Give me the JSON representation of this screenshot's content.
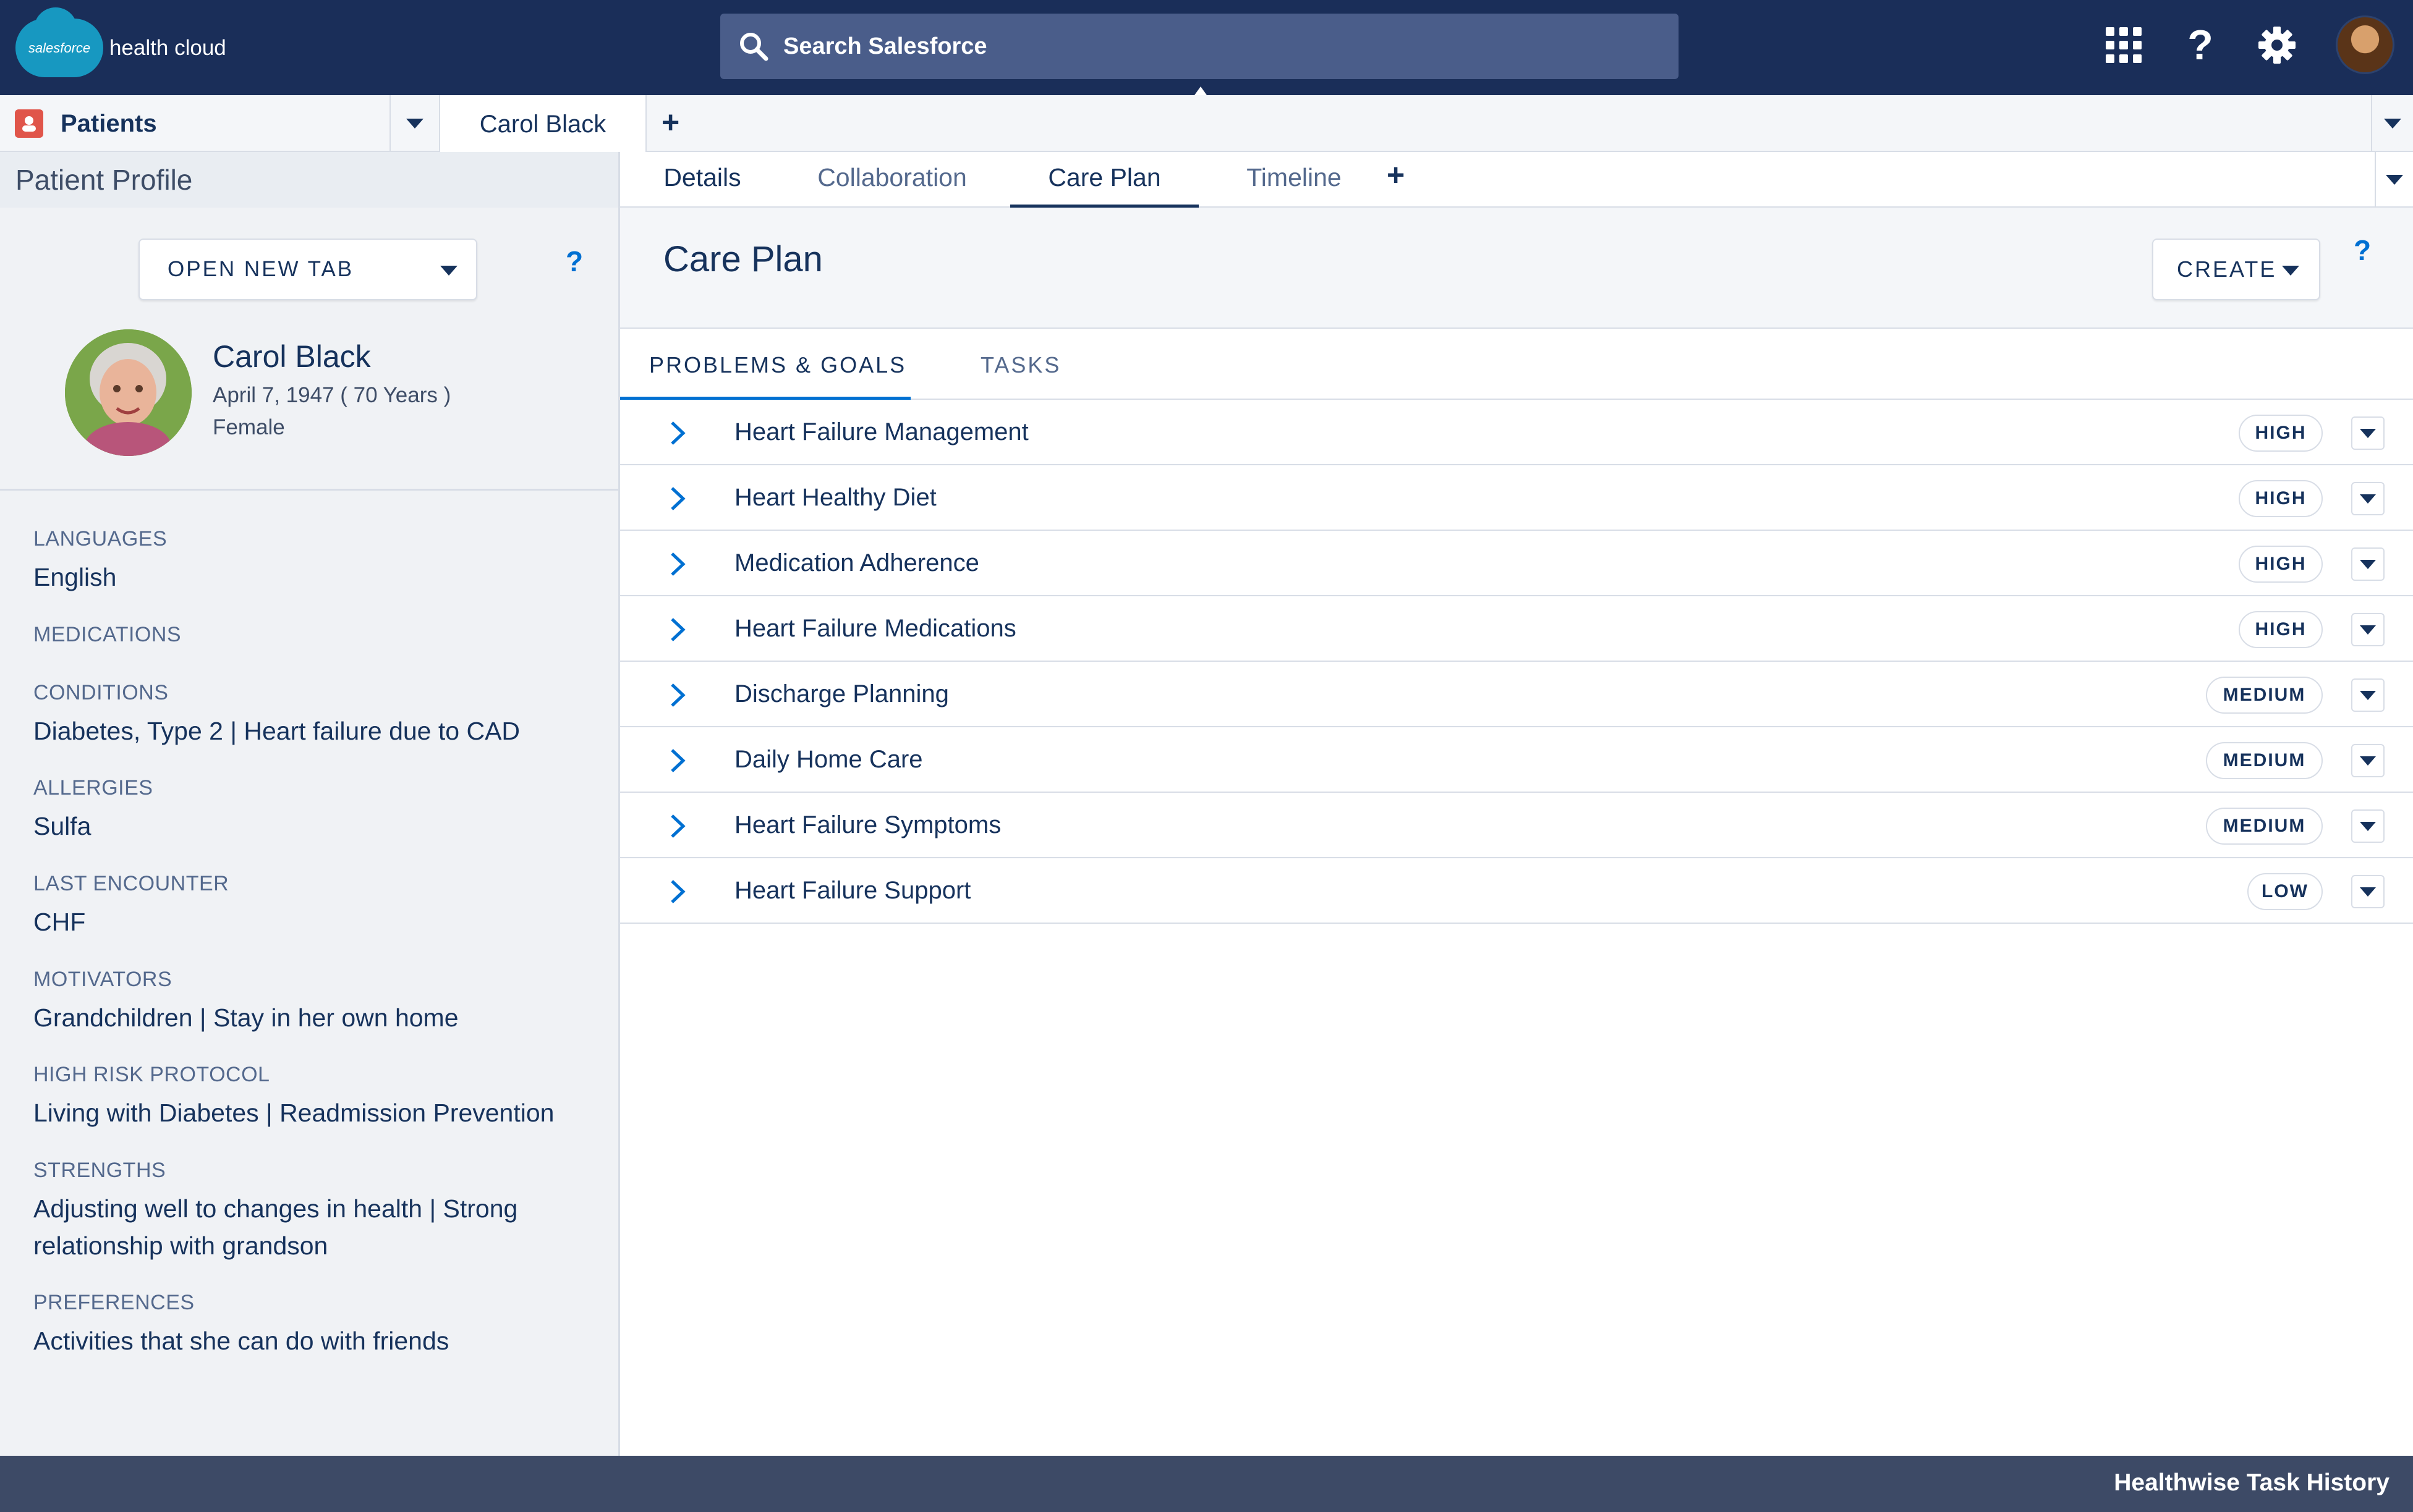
{
  "header": {
    "logo_badge": "salesforce",
    "logo_text": "health cloud",
    "search_placeholder": "Search Salesforce",
    "icons": [
      "search-icon",
      "app-launcher-icon",
      "help-icon",
      "gear-icon",
      "user-avatar"
    ]
  },
  "workspace_tabs": {
    "primary": "Patients",
    "open_tab": "Carol Black"
  },
  "left_panel": {
    "title": "Patient Profile",
    "open_new_tab": "OPEN NEW TAB",
    "help": "?",
    "patient": {
      "name": "Carol Black",
      "dob": "April 7, 1947 ( 70 Years )",
      "gender": "Female"
    },
    "fields": [
      {
        "label": "LANGUAGES",
        "value": "English"
      },
      {
        "label": "MEDICATIONS",
        "value": ""
      },
      {
        "label": "CONDITIONS",
        "value": "Diabetes, Type 2 | Heart failure due to CAD"
      },
      {
        "label": "ALLERGIES",
        "value": "Sulfa"
      },
      {
        "label": "LAST ENCOUNTER",
        "value": "CHF"
      },
      {
        "label": "MOTIVATORS",
        "value": "Grandchildren | Stay in her own home"
      },
      {
        "label": "HIGH RISK PROTOCOL",
        "value": "Living with Diabetes | Readmission Prevention"
      },
      {
        "label": "STRENGTHS",
        "value": "Adjusting well to changes in health | Strong relationship with grandson"
      },
      {
        "label": "PREFERENCES",
        "value": "Activities that she can do with friends"
      }
    ]
  },
  "sub_tabs": [
    "Details",
    "Collaboration",
    "Care Plan",
    "Timeline"
  ],
  "sub_tab_active": "Care Plan",
  "care_plan": {
    "title": "Care Plan",
    "create_label": "CREATE",
    "help": "?",
    "tabs": [
      "PROBLEMS & GOALS",
      "TASKS"
    ],
    "active_tab": "PROBLEMS & GOALS",
    "problems": [
      {
        "title": "Heart Failure Management",
        "priority": "HIGH"
      },
      {
        "title": "Heart Healthy Diet",
        "priority": "HIGH"
      },
      {
        "title": "Medication Adherence",
        "priority": "HIGH"
      },
      {
        "title": "Heart Failure Medications",
        "priority": "HIGH"
      },
      {
        "title": "Discharge Planning",
        "priority": "MEDIUM"
      },
      {
        "title": "Daily Home Care",
        "priority": "MEDIUM"
      },
      {
        "title": "Heart Failure Symptoms",
        "priority": "MEDIUM"
      },
      {
        "title": "Heart Failure Support",
        "priority": "LOW"
      }
    ]
  },
  "footer": {
    "label": "Healthwise Task History"
  },
  "colors": {
    "header_bg": "#1a2e59",
    "search_bg": "#4a5d8a",
    "link_blue": "#0070d2",
    "text_dark": "#16325c",
    "footer_bg": "#3d4a66"
  }
}
